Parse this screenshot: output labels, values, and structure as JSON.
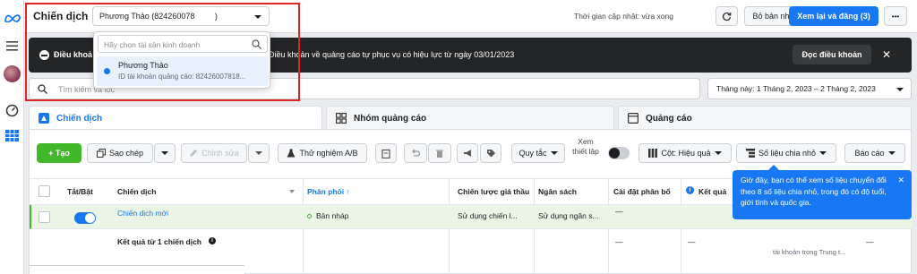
{
  "colors": {
    "accent": "#1877f2",
    "alert_outline": "#e02424",
    "banner": "#242526"
  },
  "header": {
    "title": "Chiến dịch",
    "account_select": "Phương Thảo (824260078         )",
    "updated_text": "Thời gian cập nhật: vừa xong",
    "discard_label": "Bỏ bản nháp",
    "publish_label": "Xem lại và đăng (3)",
    "more_label": "•••"
  },
  "account_dropdown": {
    "placeholder": "Hãy chọn tài sản kinh doanh",
    "item_name": "Phương Thảo",
    "item_id": "ID tài khoản quảng cáo: 82426007818..."
  },
  "banner": {
    "text_left": "Điều khoả",
    "text_right": "Điều khoản về quảng cáo tự phục vụ có hiệu lực từ ngày 03/01/2023",
    "read_label": "Đọc điều khoản"
  },
  "search": {
    "placeholder": "Tìm kiếm và lọc",
    "date_range": "Tháng này: 1 Tháng 2, 2023 – 2 Tháng 2, 2023"
  },
  "tabs": [
    {
      "label": "Chiến dịch"
    },
    {
      "label": "Nhóm quảng cáo"
    },
    {
      "label": "Quảng cáo"
    }
  ],
  "toolbar": {
    "create": "+ Tạo",
    "duplicate": "Sao chép",
    "edit": "Chỉnh sửa",
    "ab_test": "Thử nghiệm A/B",
    "rules": "Quy tắc",
    "view_setup": "Xem thiết lập",
    "columns": "Cột: Hiệu quả",
    "breakdown": "Số liệu chia nhỏ",
    "reports": "Báo cáo"
  },
  "table": {
    "headers": [
      "Tắt/Bật",
      "Chiến dịch",
      "Phân phối ↑",
      "Chiến lược giá thầu",
      "Ngân sách",
      "Cài đặt phân bổ",
      "Kết quả"
    ],
    "row": {
      "campaign": "Chiến dịch mới",
      "delivery": "Bản nháp",
      "bid": "Sử dụng chiến l...",
      "budget": "Sử dụng ngân s...",
      "attribution": "—",
      "dash2": "—",
      "dash3": "—"
    },
    "summary": {
      "label": "Kết quả từ 1 chiến dịch",
      "dash1": "—",
      "dash2": "—",
      "account_note": "tài khoản trong Trung t...",
      "dash3": "—"
    }
  },
  "tooltip": {
    "text": "Giờ đây, bạn có thể xem số liệu chuyển đổi theo 8 số liệu chia nhỏ, trong đó có độ tuổi, giới tính và quốc gia.",
    "close": "✕"
  }
}
